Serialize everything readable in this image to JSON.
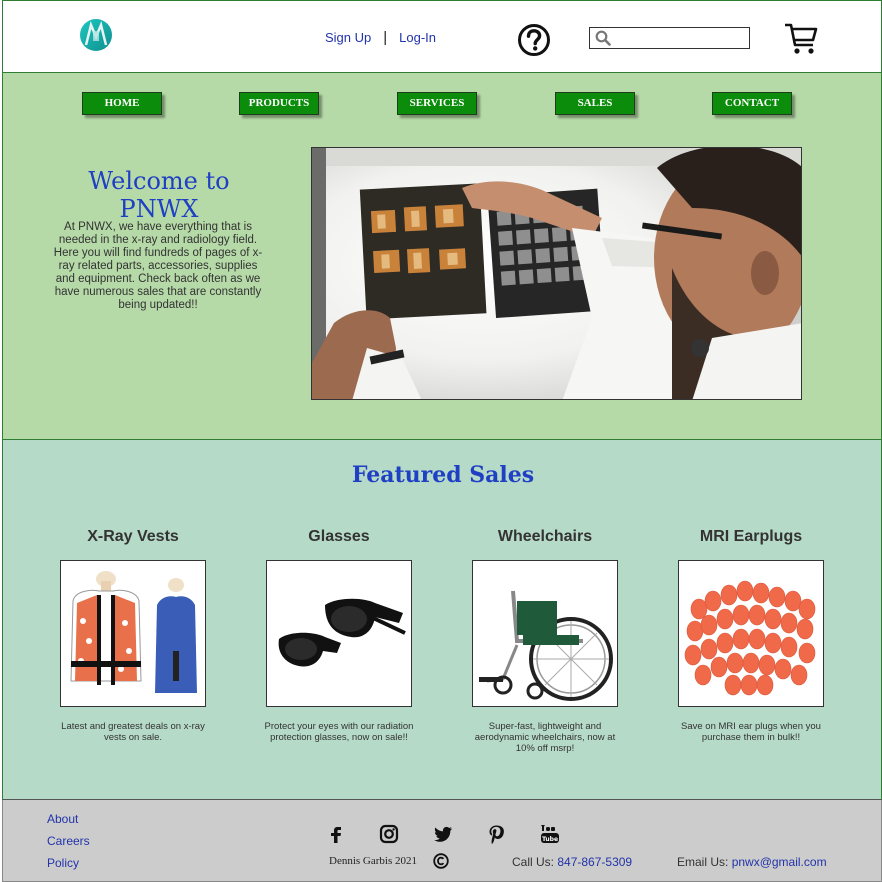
{
  "header": {
    "logo_icon": "pnwx-logo-icon",
    "signup": "Sign Up",
    "separator": "|",
    "login": "Log-In",
    "help_icon": "question-circle-icon",
    "search_icon": "search-icon",
    "search_value": "",
    "cart_icon": "cart-icon"
  },
  "nav": [
    {
      "label": "HOME"
    },
    {
      "label": "PRODUCTS"
    },
    {
      "label": "SERVICES"
    },
    {
      "label": "SALES"
    },
    {
      "label": "CONTACT"
    }
  ],
  "hero": {
    "title": "Welcome to PNWX",
    "intro": "At PNWX, we have everything that is needed in the x-ray and radiology field. Here you will find fundreds of pages of x-ray related parts, accessories, supplies and equipment. Check back often as we have numerous sales that are constantly being updated!!"
  },
  "featured": {
    "title": "Featured Sales",
    "items": [
      {
        "title": "X-Ray Vests",
        "desc": "Latest and greatest deals on x-ray vests on sale."
      },
      {
        "title": "Glasses",
        "desc": "Protect your eyes with  our radiation protection glasses, now on sale!!"
      },
      {
        "title": "Wheelchairs",
        "desc": "Super-fast, lightweight and aerodynamic wheelchairs, now at 10% off msrp!"
      },
      {
        "title": "MRI Earplugs",
        "desc": "Save on MRI ear plugs when you purchase them in bulk!!"
      }
    ]
  },
  "footer": {
    "links": [
      "About",
      "Careers",
      "Policy"
    ],
    "social_icons": [
      "facebook-icon",
      "instagram-icon",
      "twitter-icon",
      "pinterest-icon",
      "youtube-icon"
    ],
    "copyright": "Dennis Garbis 2021",
    "call_label": "Call Us:",
    "phone": "847-867-5309",
    "email_label": "Email Us:",
    "email": "pnwx@gmail.com"
  },
  "colors": {
    "nav_green": "#0b8c0b",
    "hero_bg": "#b5d9a7",
    "featured_bg": "#b6dac8",
    "footer_bg": "#cccccc",
    "title_blue": "#1f3fc4",
    "link_blue": "#2233aa"
  }
}
